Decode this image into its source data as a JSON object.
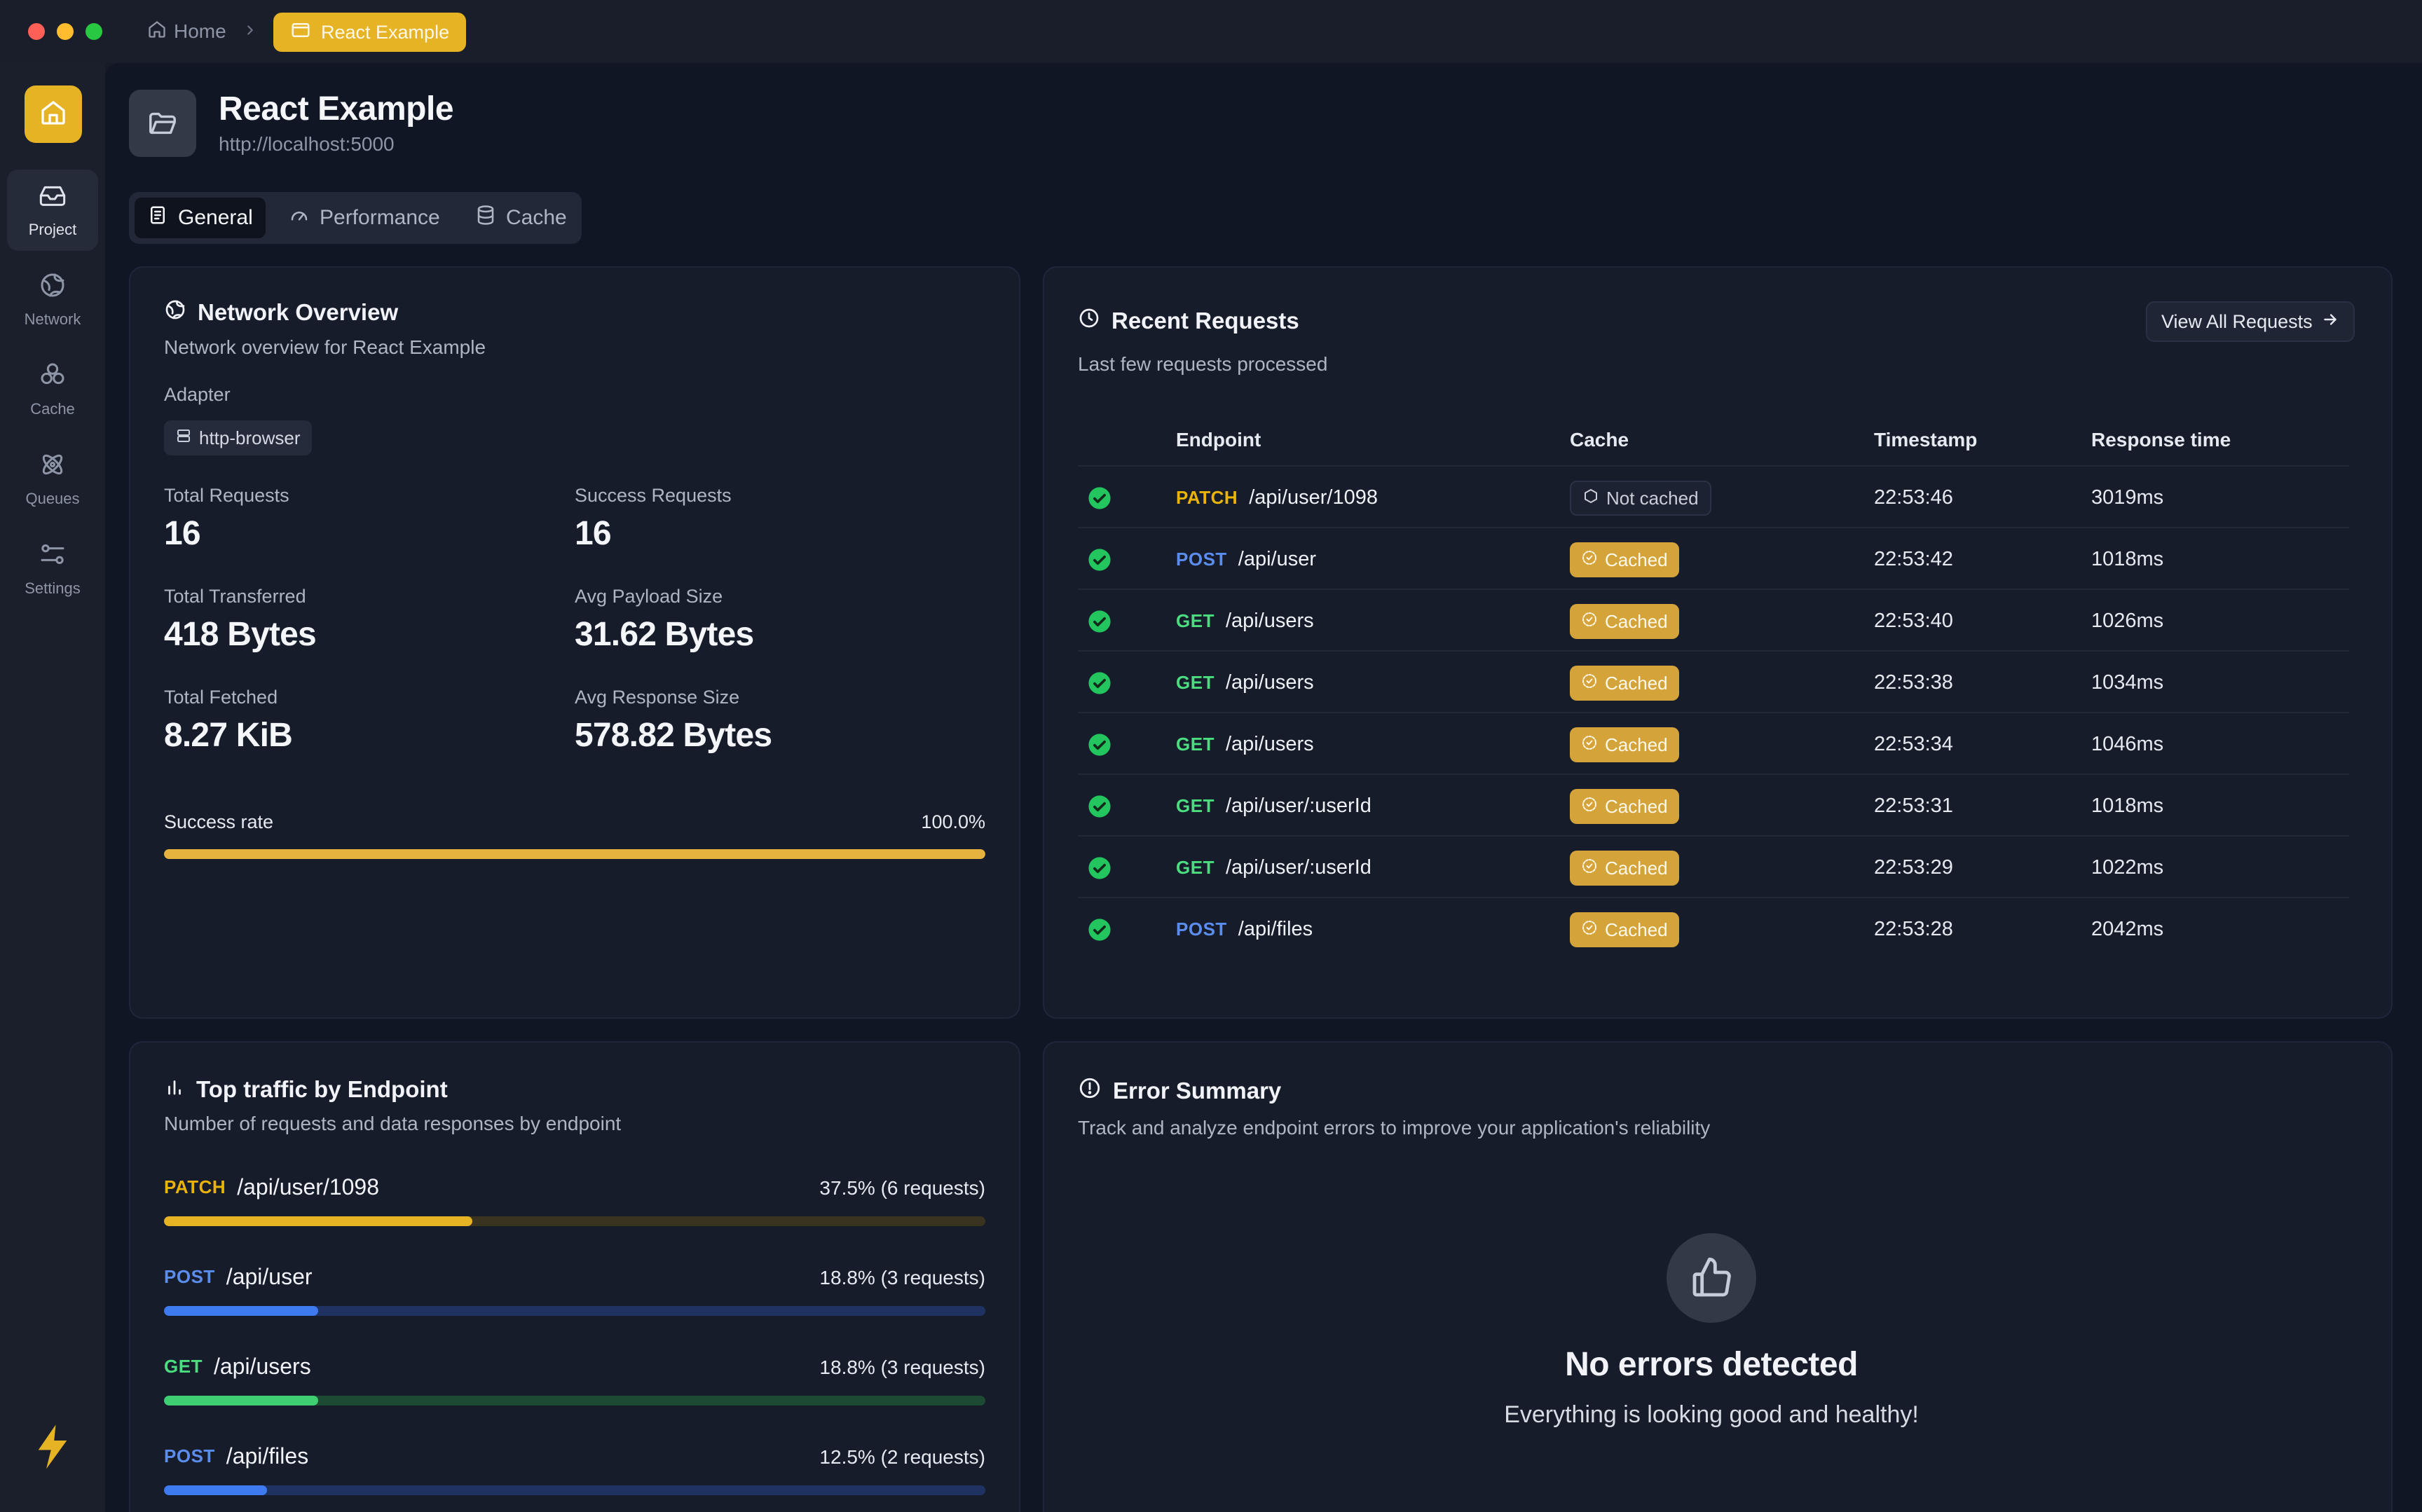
{
  "colors": {
    "accent": "#e6b325",
    "success": "#22c55e",
    "patch": "#eab308",
    "post": "#5b8def",
    "get": "#4ade80"
  },
  "breadcrumb": {
    "home": "Home",
    "current": "React Example"
  },
  "sidebar": {
    "items": [
      {
        "label": "Project",
        "icon": "inbox-icon"
      },
      {
        "label": "Network",
        "icon": "globe-icon"
      },
      {
        "label": "Cache",
        "icon": "boxes-icon"
      },
      {
        "label": "Queues",
        "icon": "atom-icon"
      },
      {
        "label": "Settings",
        "icon": "sliders-icon"
      }
    ]
  },
  "project": {
    "title": "React Example",
    "url": "http://localhost:5000"
  },
  "tabs": [
    {
      "label": "General",
      "icon": "document-icon"
    },
    {
      "label": "Performance",
      "icon": "gauge-icon"
    },
    {
      "label": "Cache",
      "icon": "database-icon"
    }
  ],
  "network": {
    "title": "Network Overview",
    "subtitle": "Network overview for React Example",
    "adapter_label": "Adapter",
    "adapter": "http-browser",
    "stats": [
      {
        "label": "Total Requests",
        "value": "16"
      },
      {
        "label": "Success Requests",
        "value": "16"
      },
      {
        "label": "Total Transferred",
        "value": "418 Bytes"
      },
      {
        "label": "Avg Payload Size",
        "value": "31.62 Bytes"
      },
      {
        "label": "Total Fetched",
        "value": "8.27 KiB"
      },
      {
        "label": "Avg Response Size",
        "value": "578.82 Bytes"
      }
    ],
    "success_rate_label": "Success rate",
    "success_rate": "100.0%",
    "success_rate_fraction": 1.0
  },
  "recent": {
    "title": "Recent Requests",
    "subtitle": "Last few requests processed",
    "view_all": "View All Requests",
    "columns": [
      "Endpoint",
      "Cache",
      "Timestamp",
      "Response time"
    ],
    "rows": [
      {
        "method": "PATCH",
        "path": "/api/user/1098",
        "cache": "Not cached",
        "cached": false,
        "timestamp": "22:53:46",
        "response": "3019ms"
      },
      {
        "method": "POST",
        "path": "/api/user",
        "cache": "Cached",
        "cached": true,
        "timestamp": "22:53:42",
        "response": "1018ms"
      },
      {
        "method": "GET",
        "path": "/api/users",
        "cache": "Cached",
        "cached": true,
        "timestamp": "22:53:40",
        "response": "1026ms"
      },
      {
        "method": "GET",
        "path": "/api/users",
        "cache": "Cached",
        "cached": true,
        "timestamp": "22:53:38",
        "response": "1034ms"
      },
      {
        "method": "GET",
        "path": "/api/users",
        "cache": "Cached",
        "cached": true,
        "timestamp": "22:53:34",
        "response": "1046ms"
      },
      {
        "method": "GET",
        "path": "/api/user/:userId",
        "cache": "Cached",
        "cached": true,
        "timestamp": "22:53:31",
        "response": "1018ms"
      },
      {
        "method": "GET",
        "path": "/api/user/:userId",
        "cache": "Cached",
        "cached": true,
        "timestamp": "22:53:29",
        "response": "1022ms"
      },
      {
        "method": "POST",
        "path": "/api/files",
        "cache": "Cached",
        "cached": true,
        "timestamp": "22:53:28",
        "response": "2042ms"
      }
    ]
  },
  "traffic": {
    "title": "Top traffic by Endpoint",
    "subtitle": "Number of requests and data responses by endpoint",
    "rows": [
      {
        "method": "PATCH",
        "path": "/api/user/1098",
        "summary": "37.5% (6 requests)",
        "fraction": 0.375
      },
      {
        "method": "POST",
        "path": "/api/user",
        "summary": "18.8% (3 requests)",
        "fraction": 0.188
      },
      {
        "method": "GET",
        "path": "/api/users",
        "summary": "18.8% (3 requests)",
        "fraction": 0.188
      },
      {
        "method": "POST",
        "path": "/api/files",
        "summary": "12.5% (2 requests)",
        "fraction": 0.125
      }
    ]
  },
  "errors": {
    "title": "Error Summary",
    "subtitle": "Track and analyze endpoint errors to improve your application's reliability",
    "empty_title": "No errors detected",
    "empty_subtitle": "Everything is looking good and healthy!"
  }
}
